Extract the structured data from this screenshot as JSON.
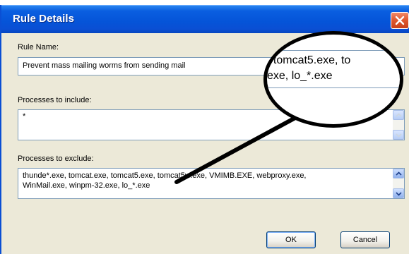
{
  "window": {
    "title": "Rule Details"
  },
  "rule_name": {
    "label": "Rule Name:",
    "value": "Prevent mass mailing worms from sending mail"
  },
  "include": {
    "label": "Processes to include:",
    "value": "*"
  },
  "exclude": {
    "label": "Processes to exclude:",
    "line1": "thunde*.exe, tomcat.exe, tomcat5.exe, tomcat5w.exe, VMIMB.EXE, webproxy.exe,",
    "line2": "WinMail.exe, winpm-32.exe, lo_*.exe"
  },
  "zoom": {
    "line1": ", tomcat5.exe, to",
    "line2": "exe, lo_*.exe"
  },
  "buttons": {
    "ok": "OK",
    "cancel": "Cancel"
  },
  "icons": [
    "close-icon",
    "scroll-up-icon",
    "scroll-down-icon"
  ]
}
